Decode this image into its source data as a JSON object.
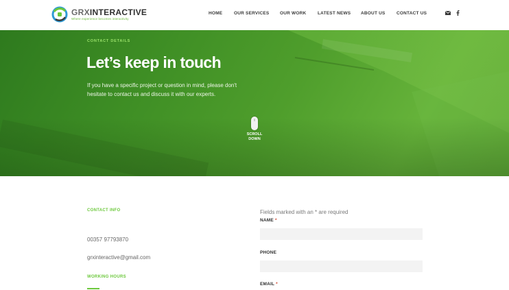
{
  "header": {
    "logo": {
      "name_part1": "GRX",
      "name_part2": "INTERACTIVE",
      "tagline": "Where experience becomes interactivity"
    },
    "nav": [
      {
        "label": "HOME"
      },
      {
        "label": "OUR SERVICES"
      },
      {
        "label": "OUR WORK"
      },
      {
        "label": "LATEST NEWS"
      },
      {
        "label": "ABOUT US"
      },
      {
        "label": "CONTACT US"
      }
    ],
    "icons": [
      "envelope-icon",
      "facebook-icon"
    ]
  },
  "hero": {
    "kicker": "CONTACT DETAILS",
    "title": "Let’s keep in touch",
    "text": "If you have a specific project or question in mind, please don't hesitate to contact us and discuss it with our experts.",
    "scroll_line1": "SCROLL",
    "scroll_line2": "DOWN"
  },
  "contact_info": {
    "heading": "CONTACT INFO",
    "phone": "00357 97793870",
    "email": "grxinteractive@gmail.com",
    "hours_heading": "WORKING HOURS"
  },
  "form": {
    "required_note": "Fields marked with an * are required",
    "fields": [
      {
        "label": "NAME",
        "required_mark": " *",
        "value": ""
      },
      {
        "label": "PHONE",
        "required_mark": "",
        "value": ""
      },
      {
        "label": "EMAIL",
        "required_mark": " *",
        "value": ""
      }
    ]
  },
  "colors": {
    "accent_green": "#6cc83c",
    "hero_green": "#3f8f25",
    "required_red": "#d0462e"
  }
}
